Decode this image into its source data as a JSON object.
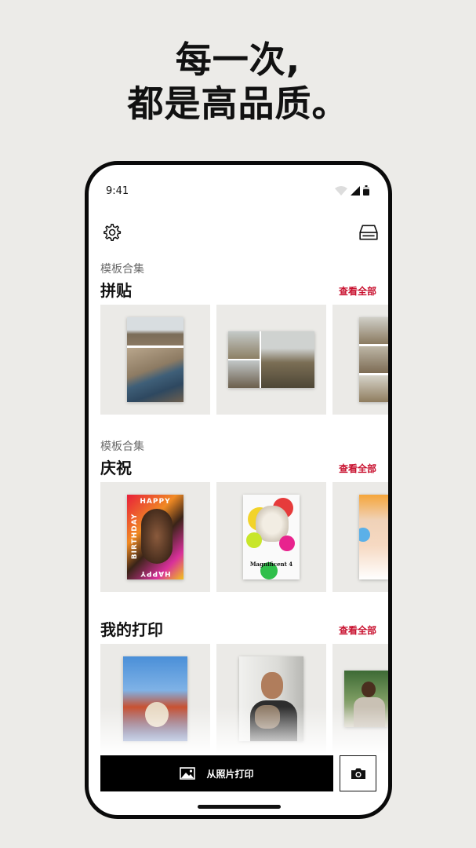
{
  "headline": {
    "line1": "每一次,",
    "line2": "都是高品质。"
  },
  "status_bar": {
    "time": "9:41"
  },
  "sections": [
    {
      "subtitle": "模板合集",
      "title": "拼贴",
      "see_all": "查看全部"
    },
    {
      "subtitle": "模板合集",
      "title": "庆祝",
      "see_all": "查看全部"
    },
    {
      "title": "我的打印",
      "see_all": "查看全部"
    }
  ],
  "cards": {
    "birthday_top": "HAPPY",
    "birthday_side": "BIRTHDAY",
    "birthday_bottom": "HAPPY",
    "dog_caption": "Magnificent 4"
  },
  "actions": {
    "print_from_photos": "从照片打印"
  },
  "colors": {
    "accent": "#c8102e",
    "background": "#ecebe8",
    "button": "#000000"
  },
  "icons": [
    "gear-icon",
    "printer-icon",
    "image-icon",
    "camera-icon",
    "wifi-icon",
    "signal-icon",
    "battery-icon"
  ]
}
